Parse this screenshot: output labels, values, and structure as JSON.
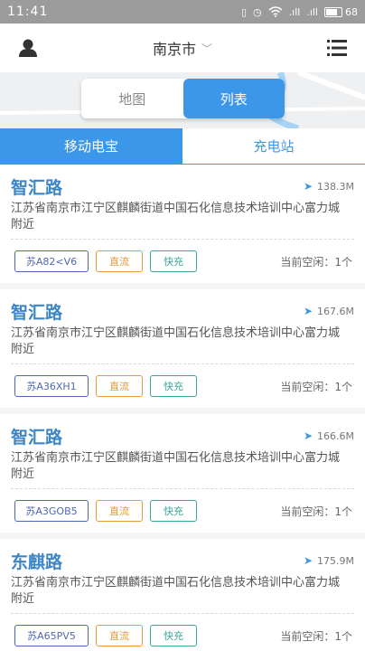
{
  "status_bar": {
    "time": "11:41",
    "signal_1": ".ıll",
    "signal_2": ".ıll",
    "battery": "68",
    "battery_level": 0.68
  },
  "header": {
    "city": "南京市"
  },
  "view_toggle": {
    "map": "地图",
    "list": "列表",
    "selected": "list"
  },
  "tabs": {
    "mobile_power": "移动电宝",
    "charging_station": "充电站",
    "selected": "mobile_power"
  },
  "stations": [
    {
      "name": "智汇路",
      "distance": "138.3M",
      "address": "江苏省南京市江宁区麒麟街道中国石化信息技术培训中心富力城附近",
      "plate": "苏A82<V6",
      "current": "直流",
      "speed": "快充",
      "vacancy": "当前空闲：1个"
    },
    {
      "name": "智汇路",
      "distance": "167.6M",
      "address": "江苏省南京市江宁区麒麟街道中国石化信息技术培训中心富力城附近",
      "plate": "苏A36XH1",
      "current": "直流",
      "speed": "快充",
      "vacancy": "当前空闲：1个"
    },
    {
      "name": "智汇路",
      "distance": "166.6M",
      "address": "江苏省南京市江宁区麒麟街道中国石化信息技术培训中心富力城附近",
      "plate": "苏A3GOB5",
      "current": "直流",
      "speed": "快充",
      "vacancy": "当前空闲：1个"
    },
    {
      "name": "东麒路",
      "distance": "175.9M",
      "address": "江苏省南京市江宁区麒麟街道中国石化信息技术培训中心富力城附近",
      "plate": "苏A65PV5",
      "current": "直流",
      "speed": "快充",
      "vacancy": "当前空闲：1个"
    }
  ],
  "icons": {
    "user": "user-icon",
    "menu": "menu-list-icon",
    "location": "location-arrow-icon"
  }
}
